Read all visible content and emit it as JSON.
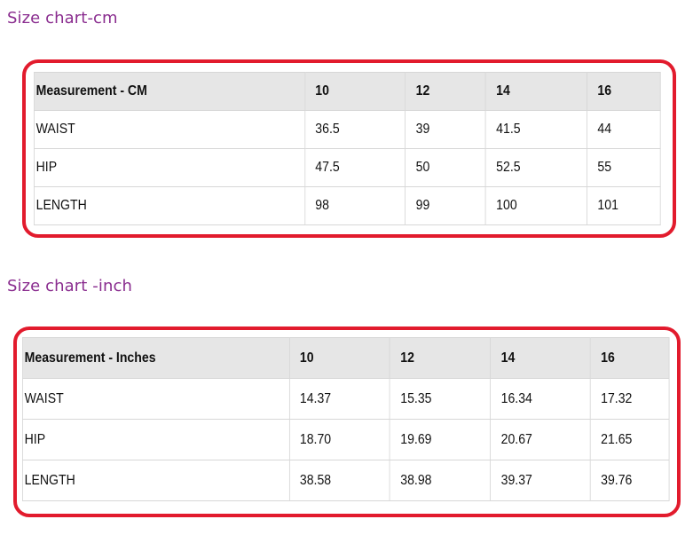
{
  "sections": [
    {
      "title": "Size chart-cm",
      "headers": [
        "Measurement - CM",
        "10",
        "12",
        "14",
        "16"
      ],
      "rows": [
        [
          "WAIST",
          "36.5",
          "39",
          "41.5",
          "44"
        ],
        [
          "HIP",
          "47.5",
          "50",
          "52.5",
          "55"
        ],
        [
          "LENGTH",
          "98",
          "99",
          "100",
          "101"
        ]
      ]
    },
    {
      "title": "Size chart -inch",
      "headers": [
        "Measurement - Inches",
        "10",
        "12",
        "14",
        "16"
      ],
      "rows": [
        [
          "WAIST",
          "14.37",
          "15.35",
          "16.34",
          "17.32"
        ],
        [
          "HIP",
          "18.70",
          "19.69",
          "20.67",
          "21.65"
        ],
        [
          "LENGTH",
          "38.58",
          "38.98",
          "39.37",
          "39.76"
        ]
      ]
    }
  ],
  "colors": {
    "title": "#8a2d8f",
    "highlight_frame": "#e21b2d",
    "header_background": "#e6e6e6",
    "cell_border": "#d7d7d7"
  }
}
